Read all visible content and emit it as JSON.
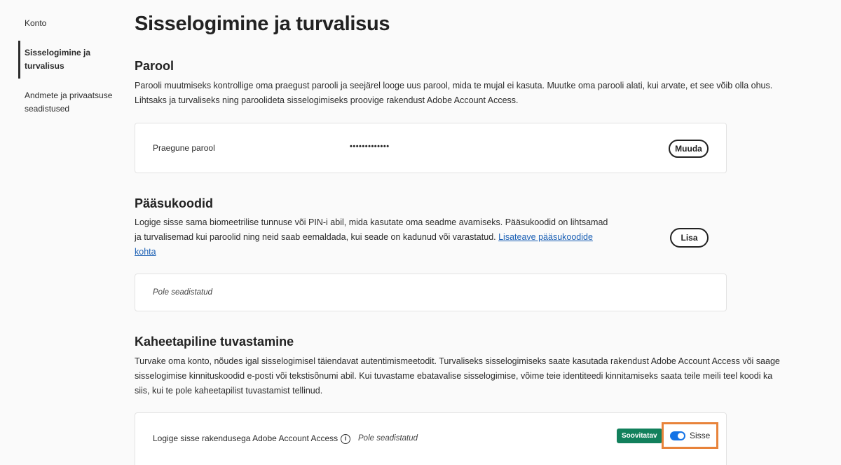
{
  "sidebar": {
    "items": [
      {
        "label": "Konto"
      },
      {
        "label": "Sisselogimine ja turvalisus"
      },
      {
        "label_line1": "Andmete ja privaatsuse",
        "label_line2": "seadistused"
      }
    ]
  },
  "page": {
    "title": "Sisselogimine ja turvalisus"
  },
  "password": {
    "heading": "Parool",
    "description_line1": "Parooli muutmiseks kontrollige oma praegust parooli ja seejärel looge uus parool, mida te mujal ei kasuta. Muutke oma parooli alati, kui arvate, et see võib olla ohus.",
    "description_line2": "Lihtsaks ja turvaliseks ning paroolideta sisselogimiseks proovige rakendust Adobe Account Access.",
    "current_label": "Praegune parool",
    "masked_value": "•••••••••••••",
    "change_button": "Muuda"
  },
  "passkeys": {
    "heading": "Pääsukoodid",
    "description_line1": "Logige sisse sama biomeetrilise tunnuse või PIN-i abil, mida kasutate oma seadme avamiseks. Pääsukoodid on lihtsamad",
    "description_line2": "ja turvalisemad kui paroolid ning neid saab eemaldada, kui seade on kadunud või varastatud.",
    "link_part1": "Lisateave pääsukoodide",
    "link_part2": "kohta",
    "add_button": "Lisa",
    "status": "Pole seadistatud"
  },
  "two_factor": {
    "heading": "Kaheetapiline tuvastamine",
    "description_line1": "Turvake oma konto, nõudes igal sisselogimisel täiendavat autentimismeetodit. Turvaliseks sisselogimiseks saate kasutada rakendust Adobe Account Access või saage",
    "description_line2": "sisselogimise kinnituskoodid e-posti või tekstisõnumi abil. Kui tuvastame ebatavalise sisselogimise, võime teie identiteedi kinnitamiseks saata teile meili teel koodi ka",
    "description_line3": "siis, kui te pole kaheetapilist tuvastamist tellinud.",
    "app_label": "Logige sisse rakendusega Adobe Account Access",
    "info_icon_glyph": "i",
    "app_status": "Pole seadistatud",
    "badge": "Soovitatav",
    "toggle_label": "Sisse",
    "toggle_on": true,
    "toggle_color": "#1473e6",
    "badge_color": "#12805c",
    "highlight_color": "#e8833a"
  }
}
